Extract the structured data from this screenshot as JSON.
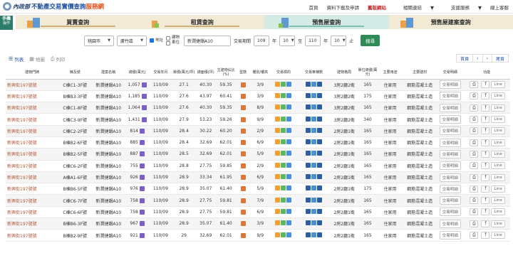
{
  "header": {
    "ministry": "內政部",
    "title_main": "不動產交易實價查詢",
    "title_accent": "服務網",
    "nav": [
      {
        "label": "首頁"
      },
      {
        "label": "資料下載及申請"
      },
      {
        "label": "舊版網站"
      },
      {
        "label": "相關連結"
      },
      {
        "label": "支援服務"
      },
      {
        "label": "線上客服"
      }
    ]
  },
  "side_badge": {
    "line1": "手機",
    "line2": "操作"
  },
  "tabs": [
    {
      "label": "買賣查詢"
    },
    {
      "label": "租賃查詢"
    },
    {
      "label": "預售屋查詢"
    },
    {
      "label": "預售屋建案查詢"
    }
  ],
  "filters": {
    "city": "桃園市",
    "district": "蘆竹區",
    "opt_address": "地址",
    "opt_project": "建物",
    "opt_unit": "車位",
    "keyword": "新潤捷韻A10",
    "period_label": "交易期間",
    "from_year": "109",
    "year_unit": "年",
    "from_month": "10",
    "to_label": "至",
    "to_year": "110",
    "to_month": "10",
    "end_label": "止",
    "search_label": "搜尋"
  },
  "views": {
    "list": "列表",
    "map": "地圖",
    "print": "列印"
  },
  "pager": {
    "first": "首頁",
    "prev": "‹",
    "next": "›",
    "last": "尾頁"
  },
  "table": {
    "headers": [
      "建物門牌",
      "棟及號",
      "建案名稱",
      "總價(萬元)",
      "交易年月",
      "單價(萬元/坪)",
      "總面積(坪)",
      "主建物佔比(%)",
      "型態",
      "樓別/樓高",
      "交易標的",
      "交易筆棟數",
      "建物格局",
      "單位總價(萬元)",
      "主要用途",
      "主要建材",
      "交易明細",
      "功能"
    ],
    "rows": [
      {
        "addr": "新興街197號號",
        "unit": "C棟C1-3F號",
        "project": "新潤捷韻A10",
        "total": "1,057",
        "ym": "110/09",
        "unit_price": "27.1",
        "area": "40.30",
        "ratio": "59.35",
        "floor": "3/9",
        "count": "1 1 1",
        "layout": "3房2廳2衛",
        "up": "165",
        "use": "住家用",
        "mat": "鋼筋混凝土造"
      },
      {
        "addr": "新興街197號號",
        "unit": "B棟B3-3F號",
        "project": "新潤捷韻A10",
        "total": "1,185",
        "ym": "110/09",
        "unit_price": "27.6",
        "area": "43.97",
        "ratio": "60.41",
        "floor": "3/9",
        "count": "1 1 1",
        "layout": "3房2廳2衛",
        "up": "175",
        "use": "住家用",
        "mat": "鋼筋混凝土造"
      },
      {
        "addr": "新興街197號號",
        "unit": "C棟C1-8F號",
        "project": "新潤捷韻A10",
        "total": "1,064",
        "ym": "110/09",
        "unit_price": "27.6",
        "area": "40.30",
        "ratio": "59.35",
        "floor": "8/9",
        "count": "1 1 1",
        "layout": "3房2廳2衛",
        "up": "165",
        "use": "住家用",
        "mat": "鋼筋混凝土造"
      },
      {
        "addr": "新興街197號號",
        "unit": "C棟C3-9F號",
        "project": "新潤捷韻A10",
        "total": "1,431",
        "ym": "110/09",
        "unit_price": "27.9",
        "area": "53.23",
        "ratio": "59.26",
        "floor": "9/9",
        "count": "1 1 2",
        "layout": "3房2廳2衛",
        "up": "340",
        "use": "住家用",
        "mat": "鋼筋混凝土造"
      },
      {
        "addr": "新興街197號號",
        "unit": "C棟C2-2F號",
        "project": "新潤捷韻A10",
        "total": "814",
        "ym": "110/09",
        "unit_price": "28.4",
        "area": "30.22",
        "ratio": "60.20",
        "floor": "2/9",
        "count": "1 1 1",
        "layout": "2房2廳1衛",
        "up": "165",
        "use": "住家用",
        "mat": "鋼筋混凝土造"
      },
      {
        "addr": "新興街197號號",
        "unit": "B棟B2-6F號",
        "project": "新潤捷韻A10",
        "total": "885",
        "ym": "110/09",
        "unit_price": "28.4",
        "area": "32.69",
        "ratio": "62.01",
        "floor": "6/9",
        "count": "1 1 1",
        "layout": "2房2廳1衛",
        "up": "165",
        "use": "住家用",
        "mat": "鋼筋混凝土造"
      },
      {
        "addr": "新興街197號號",
        "unit": "B棟B2-5F號",
        "project": "新潤捷韻A10",
        "total": "887",
        "ym": "110/09",
        "unit_price": "28.5",
        "area": "32.69",
        "ratio": "62.01",
        "floor": "5/9",
        "count": "1 1 1",
        "layout": "2房2廳1衛",
        "up": "165",
        "use": "住家用",
        "mat": "鋼筋混凝土造"
      },
      {
        "addr": "新興街197號號",
        "unit": "C棟C6-2F號",
        "project": "新潤捷韻A10",
        "total": "755",
        "ym": "110/09",
        "unit_price": "28.8",
        "area": "27.75",
        "ratio": "59.85",
        "floor": "2/9",
        "count": "1 1 1",
        "layout": "2房2廳1衛",
        "up": "165",
        "use": "住家用",
        "mat": "鋼筋混凝土造"
      },
      {
        "addr": "新興街197號號",
        "unit": "A棟A1-6F號",
        "project": "新潤捷韻A10",
        "total": "926",
        "ym": "110/09",
        "unit_price": "28.9",
        "area": "33.34",
        "ratio": "61.95",
        "floor": "6/9",
        "count": "1 1 1",
        "layout": "2房2廳1衛",
        "up": "165",
        "use": "住家用",
        "mat": "鋼筋混凝土造"
      },
      {
        "addr": "新興街197號號",
        "unit": "B棟B6-5F號",
        "project": "新潤捷韻A10",
        "total": "976",
        "ym": "110/09",
        "unit_price": "28.9",
        "area": "35.07",
        "ratio": "61.40",
        "floor": "5/9",
        "count": "1 1 1",
        "layout": "2房2廳1衛",
        "up": "175",
        "use": "住家用",
        "mat": "鋼筋混凝土造"
      },
      {
        "addr": "新興街197號號",
        "unit": "C棟C6-7F號",
        "project": "新潤捷韻A10",
        "total": "758",
        "ym": "110/09",
        "unit_price": "28.9",
        "area": "27.75",
        "ratio": "59.81",
        "floor": "7/9",
        "count": "1 1 1",
        "layout": "2房2廳1衛",
        "up": "165",
        "use": "住家用",
        "mat": "鋼筋混凝土造"
      },
      {
        "addr": "新興街197號號",
        "unit": "C棟C6-6F號",
        "project": "新潤捷韻A10",
        "total": "758",
        "ym": "110/09",
        "unit_price": "28.9",
        "area": "27.75",
        "ratio": "59.81",
        "floor": "6/9",
        "count": "1 1 1",
        "layout": "2房2廳1衛",
        "up": "165",
        "use": "住家用",
        "mat": "鋼筋混凝土造"
      },
      {
        "addr": "新興街197號號",
        "unit": "B棟B6-3F號",
        "project": "新潤捷韻A10",
        "total": "967",
        "ym": "110/09",
        "unit_price": "28.9",
        "area": "35.07",
        "ratio": "61.40",
        "floor": "3/9",
        "count": "1 1 1",
        "layout": "2房2廳1衛",
        "up": "165",
        "use": "住家用",
        "mat": "鋼筋混凝土造"
      },
      {
        "addr": "新興街197號號",
        "unit": "B棟B2-9F號",
        "project": "新潤捷韻A10",
        "total": "921",
        "ym": "110/09",
        "unit_price": "29",
        "area": "32.69",
        "ratio": "62.01",
        "floor": "9/9",
        "count": "1 1 1",
        "layout": "2房2廳1衛",
        "up": "165",
        "use": "住家用",
        "mat": "鋼筋混凝土造"
      }
    ],
    "detail_btn": "交易明細",
    "share_btn": "Line"
  }
}
